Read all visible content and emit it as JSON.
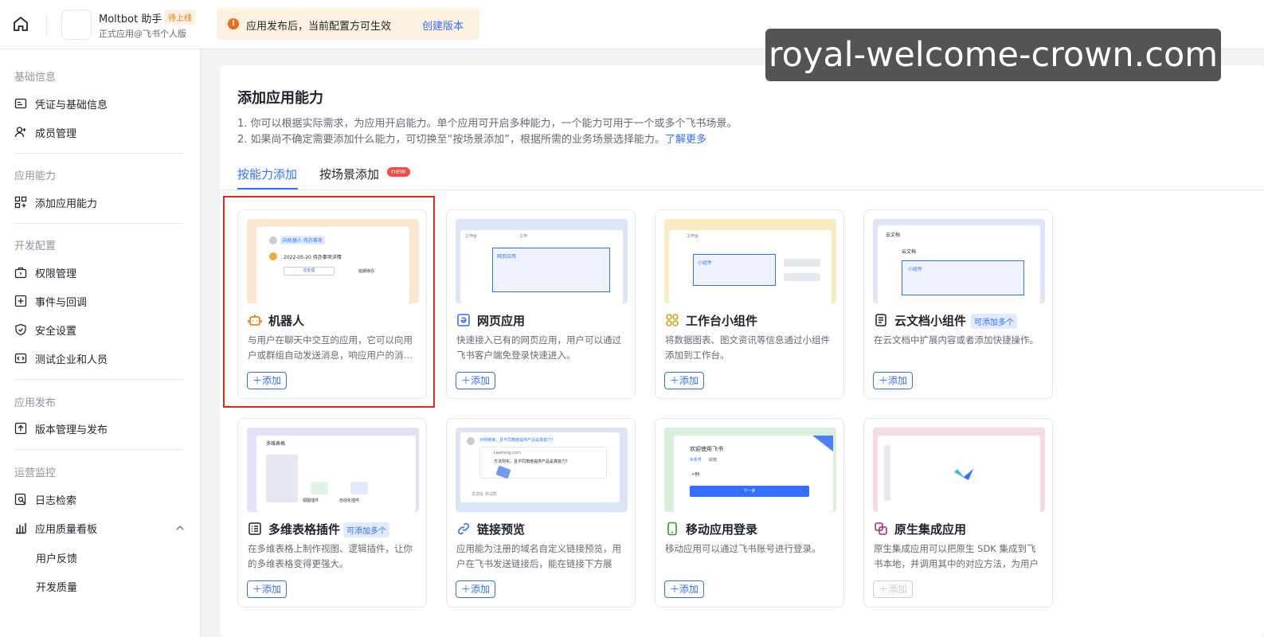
{
  "topbar": {
    "app_name": "Moltbot 助手",
    "app_status": "待上线",
    "app_subtitle": "正式应用@飞书个人版",
    "notice_text": "应用发布后，当前配置方可生效",
    "notice_action": "创建版本",
    "notice_icon": "!"
  },
  "watermark": "royal-welcome-crown.com",
  "sidebar": {
    "groups": [
      {
        "title": "基础信息",
        "items": [
          {
            "label": "凭证与基础信息",
            "icon": "id-card-icon"
          },
          {
            "label": "成员管理",
            "icon": "member-add-icon"
          }
        ]
      },
      {
        "title": "应用能力",
        "items": [
          {
            "label": "添加应用能力",
            "icon": "grid-add-icon"
          }
        ]
      },
      {
        "title": "开发配置",
        "items": [
          {
            "label": "权限管理",
            "icon": "lock-briefcase-icon"
          },
          {
            "label": "事件与回调",
            "icon": "event-icon"
          },
          {
            "label": "安全设置",
            "icon": "shield-icon"
          },
          {
            "label": "测试企业和人员",
            "icon": "code-icon"
          }
        ]
      },
      {
        "title": "应用发布",
        "items": [
          {
            "label": "版本管理与发布",
            "icon": "upload-icon"
          }
        ]
      },
      {
        "title": "运营监控",
        "items": [
          {
            "label": "日志检索",
            "icon": "log-search-icon"
          },
          {
            "label": "应用质量看板",
            "icon": "bar-chart-icon"
          }
        ],
        "subitems": [
          "用户反馈",
          "开发质量"
        ]
      }
    ]
  },
  "main": {
    "title": "添加应用能力",
    "desc1": "1. 你可以根据实际需求，为应用开启能力。单个应用可开启多种能力，一个能力可用于一个或多个飞书场景。",
    "desc2": "2. 如果尚不确定需要添加什么能力，可切换至“按场景添加”，根据所需的业务场景选择能力。",
    "desc2_link": "了解更多",
    "tabs": [
      {
        "label": "按能力添加",
        "active": true
      },
      {
        "label": "按场景添加",
        "badge": "new"
      }
    ],
    "add_label": "添加",
    "cards": [
      {
        "title": "机器人",
        "icon": "robot-icon",
        "desc": "与用户在聊天中交互的应用，它可以向用户或群组自动发送消息，响应用户的消…",
        "tag": null,
        "disabled": false,
        "illus": {
          "tag": "向机器人 待办事项",
          "date": "2022-05-20 待办事项详情",
          "btn1": "去处理",
          "btn2": "延期待办"
        }
      },
      {
        "title": "网页应用",
        "icon": "web-app-icon",
        "desc": "快速接入已有的网页应用，用户可以通过飞书客户端免登录快速进入。",
        "tag": null,
        "disabled": false,
        "illus": {
          "tab1": "工作台",
          "tab2": "工作",
          "box": "网页应用"
        }
      },
      {
        "title": "工作台小组件",
        "icon": "widget-icon",
        "desc": "将数据图表、图文资讯等信息通过小组件添加到工作台。",
        "tag": null,
        "disabled": false,
        "illus": {
          "tab1": "工作台",
          "box": "小组件"
        }
      },
      {
        "title": "云文档小组件",
        "icon": "doc-icon",
        "desc": "在云文档中扩展内容或者添加快捷操作。",
        "tag": "可添加多个",
        "disabled": false,
        "illus": {
          "head": "云文档",
          "sub": "云文档",
          "box": "小组件"
        }
      },
      {
        "title": "多维表格插件",
        "icon": "table-icon",
        "desc": "在多维表格上制作视图、逻辑插件，让你的多维表格变得更强大。",
        "tag": "可添加多个",
        "disabled": false,
        "illus": {
          "head": "多维表格",
          "label1": "视图插件",
          "label2": "自动化插件"
        }
      },
      {
        "title": "链接预览",
        "icon": "link-icon",
        "desc": "应用能为注册的域名自定义链接预览，用户在飞书发送链接后，能在链接下方展示…",
        "tag": null,
        "disabled": false,
        "illus": {
          "msg": "示例链接，且不同角度提供产品是真能力？",
          "domain": "Learning.com",
          "text": "方法则实，且不同角度提供产品是真能力?",
          "input": "发送给 测试群"
        }
      },
      {
        "title": "移动应用登录",
        "icon": "mobile-icon",
        "desc": "移动应用可以通过飞书账号进行登录。",
        "tag": null,
        "disabled": false,
        "illus": {
          "welcome": "欢迎使用飞书",
          "tab1": "手机号",
          "tab2": "邮箱",
          "prefix": "+86",
          "btn": "下一步"
        }
      },
      {
        "title": "原生集成应用",
        "icon": "native-icon",
        "desc": "原生集成应用可以把原生 SDK 集成到飞书本地，并调用其中的对应方法，为用户提…",
        "tag": null,
        "disabled": true,
        "illus": {}
      }
    ]
  },
  "colors": {
    "accent": "#3370ff",
    "warning": "#ed6c1c",
    "highlight": "#e2271a"
  }
}
